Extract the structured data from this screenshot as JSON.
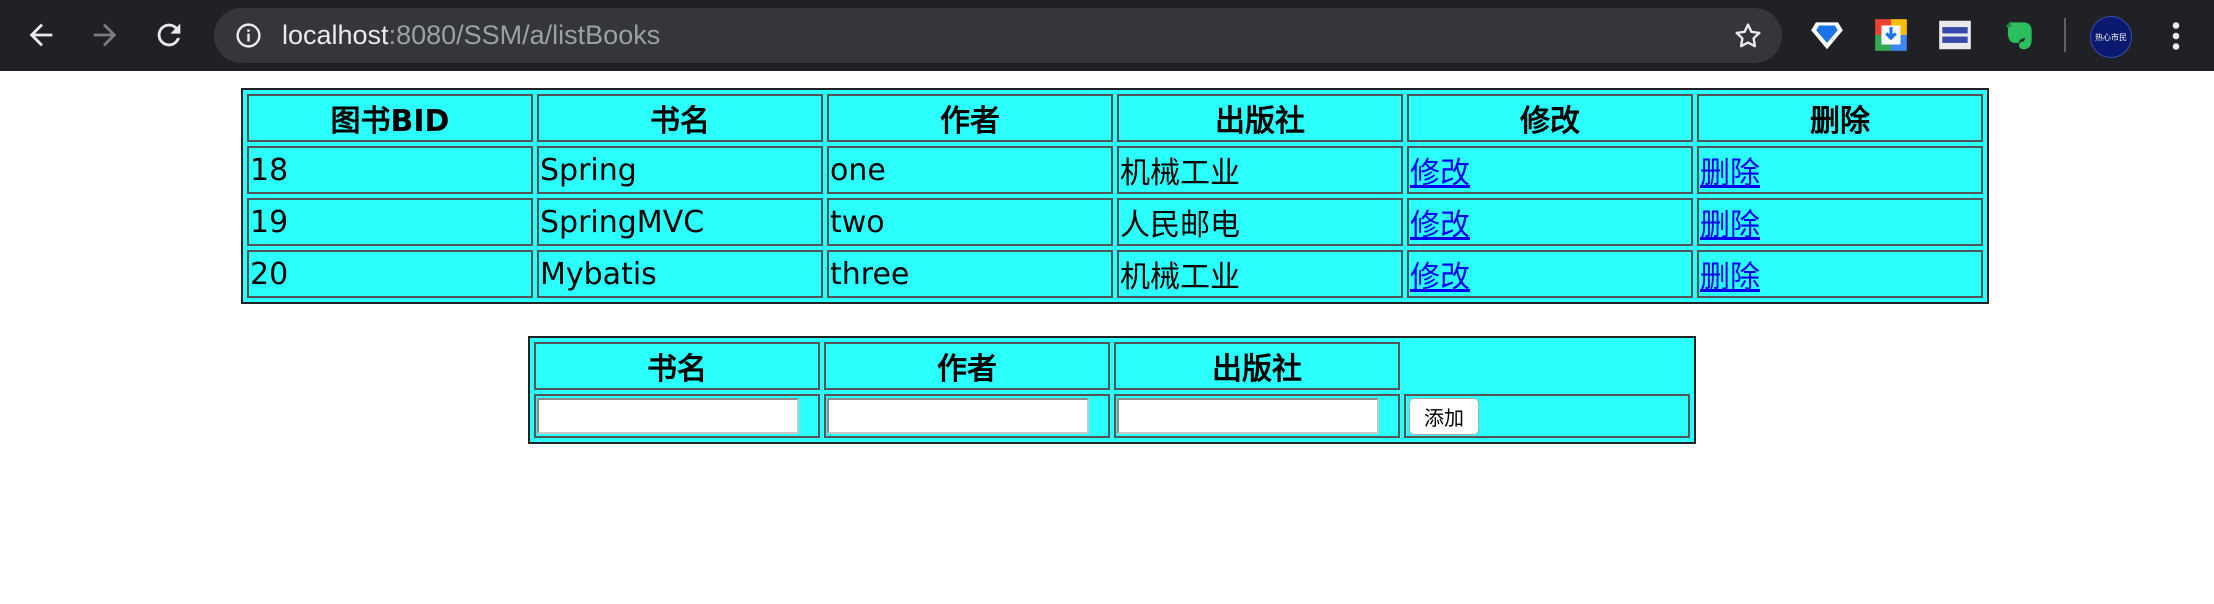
{
  "browser": {
    "url_host": "localhost",
    "url_rest": ":8080/SSM/a/listBooks",
    "avatar_text": "热心市民",
    "icons": {
      "back": "back-arrow-icon",
      "forward": "forward-arrow-icon",
      "reload": "reload-icon",
      "info": "info-icon",
      "star": "bookmark-star-icon",
      "ext1": "diamond-extension-icon",
      "ext2": "download-extension-icon",
      "ext3": "window-extension-icon",
      "ext4": "evernote-icon",
      "menu": "more-vert-icon"
    }
  },
  "list_table": {
    "headers": [
      "图书BID",
      "书名",
      "作者",
      "出版社",
      "修改",
      "删除"
    ],
    "rows": [
      {
        "bid": "18",
        "name": "Spring",
        "author": "one",
        "publisher": "机械工业",
        "edit": "修改",
        "delete": "删除"
      },
      {
        "bid": "19",
        "name": "SpringMVC",
        "author": "two",
        "publisher": "人民邮电",
        "edit": "修改",
        "delete": "删除"
      },
      {
        "bid": "20",
        "name": "Mybatis",
        "author": "three",
        "publisher": "机械工业",
        "edit": "修改",
        "delete": "删除"
      }
    ]
  },
  "add_table": {
    "headers": [
      "书名",
      "作者",
      "出版社"
    ],
    "name_value": "",
    "author_value": "",
    "publisher_value": "",
    "add_label": "添加"
  },
  "colors": {
    "table_bg": "#2bfffe",
    "link": "#0000ee",
    "chrome_bg": "#202124",
    "omnibox_bg": "#35363a"
  }
}
